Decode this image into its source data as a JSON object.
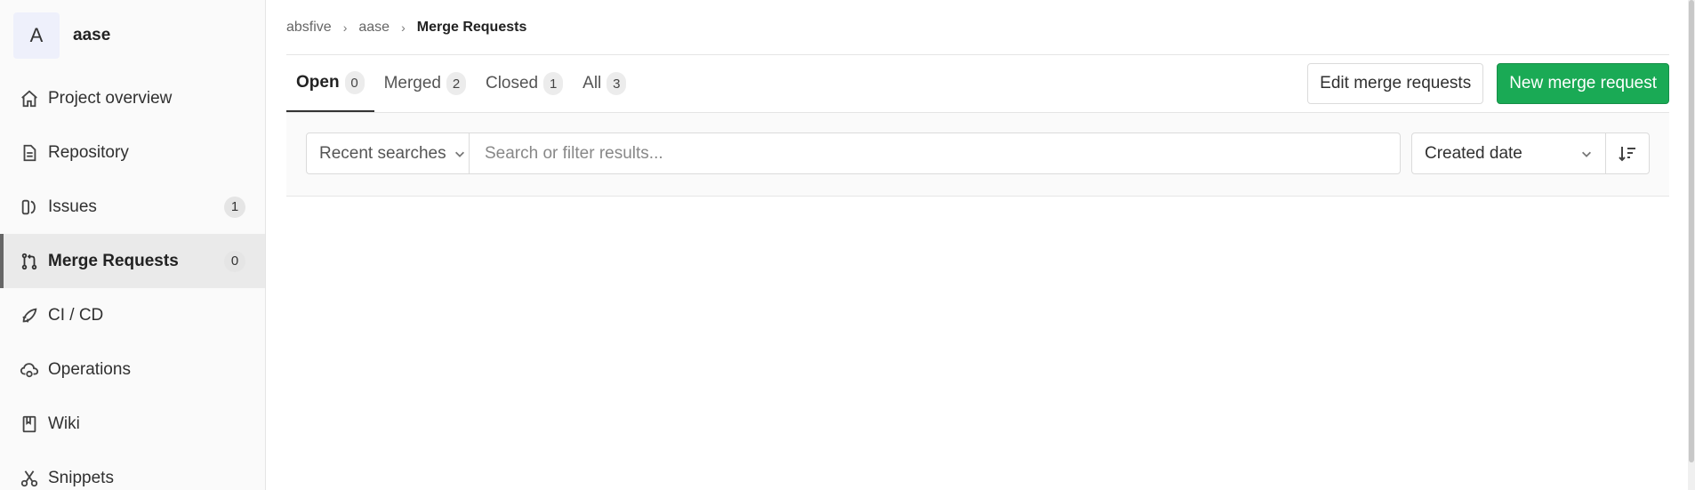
{
  "project": {
    "avatar_letter": "A",
    "name": "aase"
  },
  "sidebar": {
    "items": [
      {
        "label": "Project overview",
        "icon": "home-icon"
      },
      {
        "label": "Repository",
        "icon": "document-icon"
      },
      {
        "label": "Issues",
        "icon": "issues-icon",
        "badge": "1"
      },
      {
        "label": "Merge Requests",
        "icon": "merge-request-icon",
        "badge": "0",
        "active": true
      },
      {
        "label": "CI / CD",
        "icon": "rocket-icon"
      },
      {
        "label": "Operations",
        "icon": "cloud-gear-icon"
      },
      {
        "label": "Wiki",
        "icon": "book-icon"
      },
      {
        "label": "Snippets",
        "icon": "scissors-icon"
      }
    ]
  },
  "breadcrumb": {
    "group": "absfive",
    "project": "aase",
    "current": "Merge Requests"
  },
  "tabs": [
    {
      "label": "Open",
      "count": "0",
      "active": true
    },
    {
      "label": "Merged",
      "count": "2"
    },
    {
      "label": "Closed",
      "count": "1"
    },
    {
      "label": "All",
      "count": "3"
    }
  ],
  "actions": {
    "edit_label": "Edit merge requests",
    "new_label": "New merge request"
  },
  "filter": {
    "recent_label": "Recent searches",
    "search_placeholder": "Search or filter results...",
    "sort_label": "Created date"
  },
  "colors": {
    "accent_success": "#1aaa55",
    "sidebar_bg": "#fafafa"
  }
}
